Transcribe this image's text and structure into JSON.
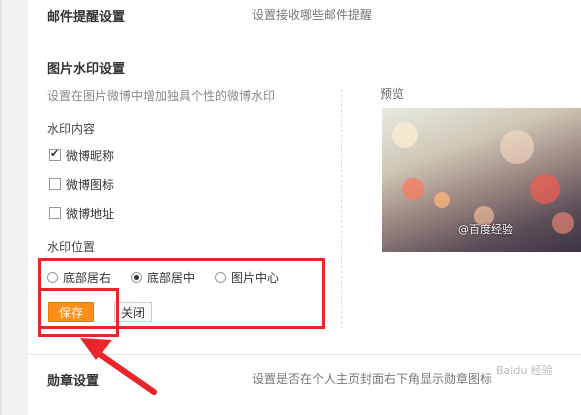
{
  "email_reminder": {
    "title": "邮件提醒设置",
    "desc": "设置接收哪些邮件提醒"
  },
  "watermark": {
    "title": "图片水印设置",
    "desc": "设置在图片微博中增加独具个性的微博水印",
    "content_label": "水印内容",
    "options": [
      {
        "label": "微博昵称",
        "checked": true
      },
      {
        "label": "微博图标",
        "checked": false
      },
      {
        "label": "微博地址",
        "checked": false
      }
    ],
    "position_label": "水印位置",
    "positions": [
      {
        "label": "底部居右",
        "checked": false
      },
      {
        "label": "底部居中",
        "checked": true
      },
      {
        "label": "图片中心",
        "checked": false
      }
    ],
    "preview_label": "预览",
    "preview_watermark_text": "@百度经验",
    "save_label": "保存",
    "close_label": "关闭"
  },
  "badge": {
    "title": "勋章设置",
    "desc": "设置是否在个人主页封面右下角显示勋章图标"
  },
  "watermark_brand": "Baidu 经验",
  "colors": {
    "accent": "#ff8d1a",
    "annotation_red": "#e8262b"
  }
}
